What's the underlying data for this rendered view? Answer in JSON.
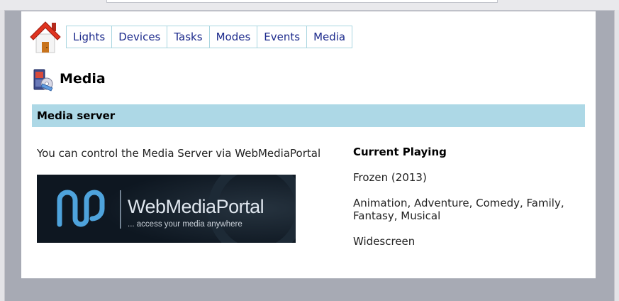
{
  "nav": {
    "items": [
      {
        "label": "Lights"
      },
      {
        "label": "Devices"
      },
      {
        "label": "Tasks"
      },
      {
        "label": "Modes"
      },
      {
        "label": "Events"
      },
      {
        "label": "Media"
      }
    ]
  },
  "page": {
    "title": "Media",
    "icon": "media-icon"
  },
  "section": {
    "title": "Media server",
    "intro": "You can control the Media Server via WebMediaPortal"
  },
  "banner": {
    "name": "WebMediaPortal",
    "tagline": "... access your media anywhere"
  },
  "current_playing": {
    "heading": "Current Playing",
    "title": "Frozen (2013)",
    "genres": "Animation, Adventure, Comedy, Family, Fantasy, Musical",
    "format": "Widescreen"
  },
  "colors": {
    "section_header_bg": "#add8e6",
    "nav_border": "#a9d6e0",
    "nav_text": "#1c2a8c",
    "banner_bg": "#0e1721",
    "banner_accent": "#4ea3dc"
  }
}
